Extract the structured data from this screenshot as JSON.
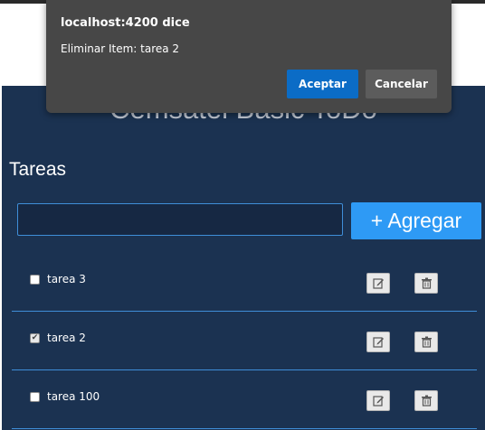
{
  "app": {
    "title": "Cemsatel Basic ToDo",
    "section_title": "Tareas",
    "input": {
      "value": "",
      "placeholder": ""
    },
    "add_button": "+ Agregar"
  },
  "tasks": [
    {
      "label": "tarea 3",
      "checked": false
    },
    {
      "label": "tarea 2",
      "checked": true
    },
    {
      "label": "tarea 100",
      "checked": false
    }
  ],
  "dialog": {
    "title": "localhost:4200 dice",
    "message": "Eliminar Item: tarea 2",
    "accept": "Aceptar",
    "cancel": "Cancelar"
  },
  "colors": {
    "app_bg": "#1b3251",
    "accent": "#2e9af5",
    "divider": "#3f8ed8",
    "dialog_bg": "#474747",
    "dialog_accept": "#0b6cc6"
  },
  "icons": {
    "edit": "edit-icon",
    "delete": "trash-icon"
  }
}
